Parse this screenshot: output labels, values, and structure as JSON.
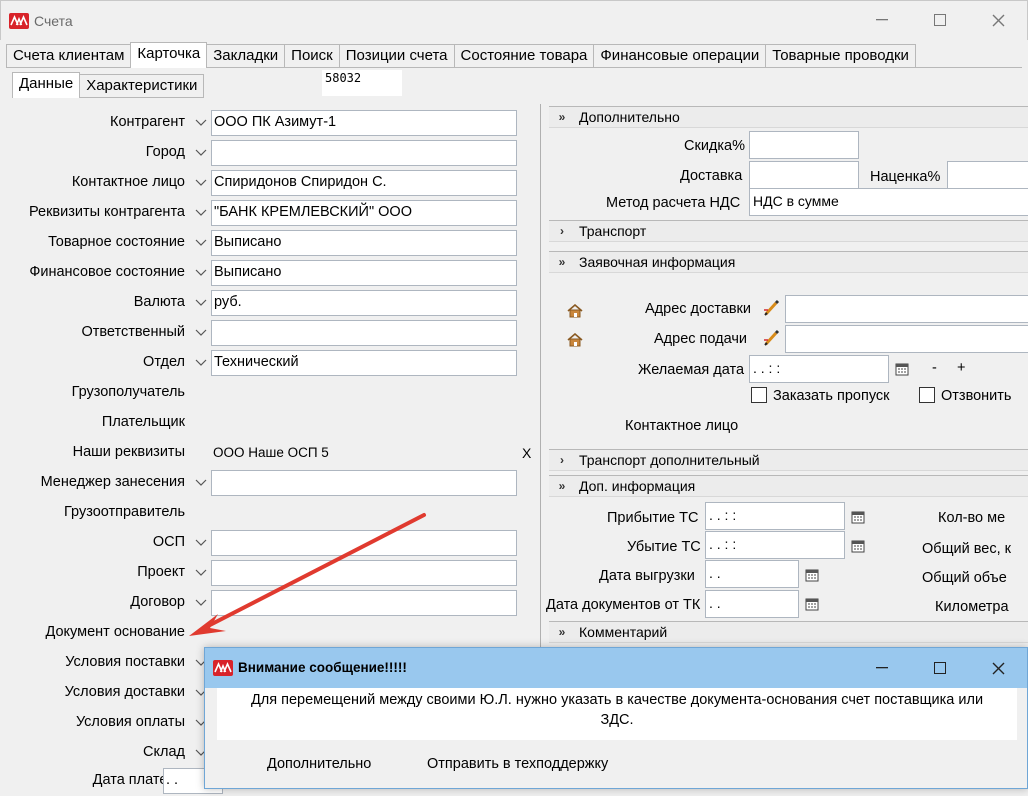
{
  "window": {
    "title": "Счета",
    "minimize": "—",
    "maximize": "☐",
    "close": "✕"
  },
  "tabs": [
    "Счета клиентам",
    "Карточка",
    "Закладки",
    "Поиск",
    "Позиции счета",
    "Состояние товара",
    "Финансовые операции",
    "Товарные проводки"
  ],
  "subtabs": [
    "Данные",
    "Характеристики"
  ],
  "record_number": "58032",
  "form": {
    "contractor": {
      "label": "Контрагент",
      "value": "ООО ПК Азимут-1"
    },
    "city": {
      "label": "Город",
      "value": ""
    },
    "contact": {
      "label": "Контактное лицо",
      "value": "Спиридонов Спиридон С."
    },
    "requisites": {
      "label": "Реквизиты контрагента",
      "value": "\"БАНК КРЕМЛЕВСКИЙ\" ООО"
    },
    "goods_state": {
      "label": "Товарное состояние",
      "value": "Выписано"
    },
    "fin_state": {
      "label": "Финансовое состояние",
      "value": "Выписано"
    },
    "currency": {
      "label": "Валюта",
      "value": "руб."
    },
    "responsible": {
      "label": "Ответственный",
      "value": ""
    },
    "department": {
      "label": "Отдел",
      "value": "Технический"
    },
    "consignee": {
      "label": "Грузополучатель"
    },
    "payer": {
      "label": "Плательщик"
    },
    "our_requisites": {
      "label": "Наши реквизиты",
      "value": "ООО Наше ОСП 5",
      "clear": "X"
    },
    "manager": {
      "label": "Менеджер занесения",
      "value": ""
    },
    "shipper": {
      "label": "Грузоотправитель"
    },
    "osp": {
      "label": "ОСП",
      "value": ""
    },
    "project": {
      "label": "Проект",
      "value": ""
    },
    "contract": {
      "label": "Договор",
      "value": ""
    },
    "base_doc": {
      "label": "Документ основание"
    },
    "supply_terms": {
      "label": "Условия поставки"
    },
    "delivery_terms": {
      "label": "Условия доставки"
    },
    "payment_terms": {
      "label": "Условия оплаты"
    },
    "warehouse": {
      "label": "Склад"
    },
    "payment_date": {
      "label": "Дата платежа",
      "value": ". ."
    }
  },
  "right": {
    "additional": {
      "title": "Дополнительно",
      "discount_label": "Скидка%",
      "delivery_label": "Доставка",
      "markup_label": "Наценка%",
      "vat_label": "Метод расчета НДС",
      "vat_value": "НДС в сумме"
    },
    "transport": {
      "title": "Транспорт"
    },
    "request": {
      "title": "Заявочная информация",
      "delivery_addr_label": "Адрес доставки",
      "pickup_addr_label": "Адрес подачи",
      "desired_date_label": "Желаемая дата",
      "desired_date_value": ". .       : :",
      "minus": "-",
      "plus": "+",
      "pass_label": "Заказать пропуск",
      "call_label": "Отзвонить",
      "contact_label": "Контактное лицо"
    },
    "transport_extra": {
      "title": "Транспорт дополнительный"
    },
    "extra_info": {
      "title": "Доп. информация",
      "arrival_label": "Прибытие ТС",
      "arrival_value": ". .       : :",
      "departure_label": "Убытие ТС",
      "departure_value": ". .       : :",
      "unload_label": "Дата выгрузки",
      "unload_value": ". .",
      "docs_date_label": "Дата документов от ТК",
      "docs_date_value": ". .",
      "qty_label": "Кол-во ме",
      "weight_label": "Общий вес, к",
      "volume_label": "Общий объе",
      "km_label": "Километра"
    },
    "comment": {
      "title": "Комментарий"
    }
  },
  "dialog": {
    "title": "Внимание сообщение!!!!!",
    "message_line1": "Для перемещений между своими Ю.Л. нужно указать в качестве документа-основания счет поставщика или",
    "message_line2": "ЗДС.",
    "more": "Дополнительно",
    "support": "Отправить в техподдержку",
    "minimize": "—",
    "maximize": "☐",
    "close": "✕"
  },
  "colors": {
    "brand": "#d8232a",
    "dialog_title": "#99c8ee",
    "arrow": "#e03a2f"
  }
}
